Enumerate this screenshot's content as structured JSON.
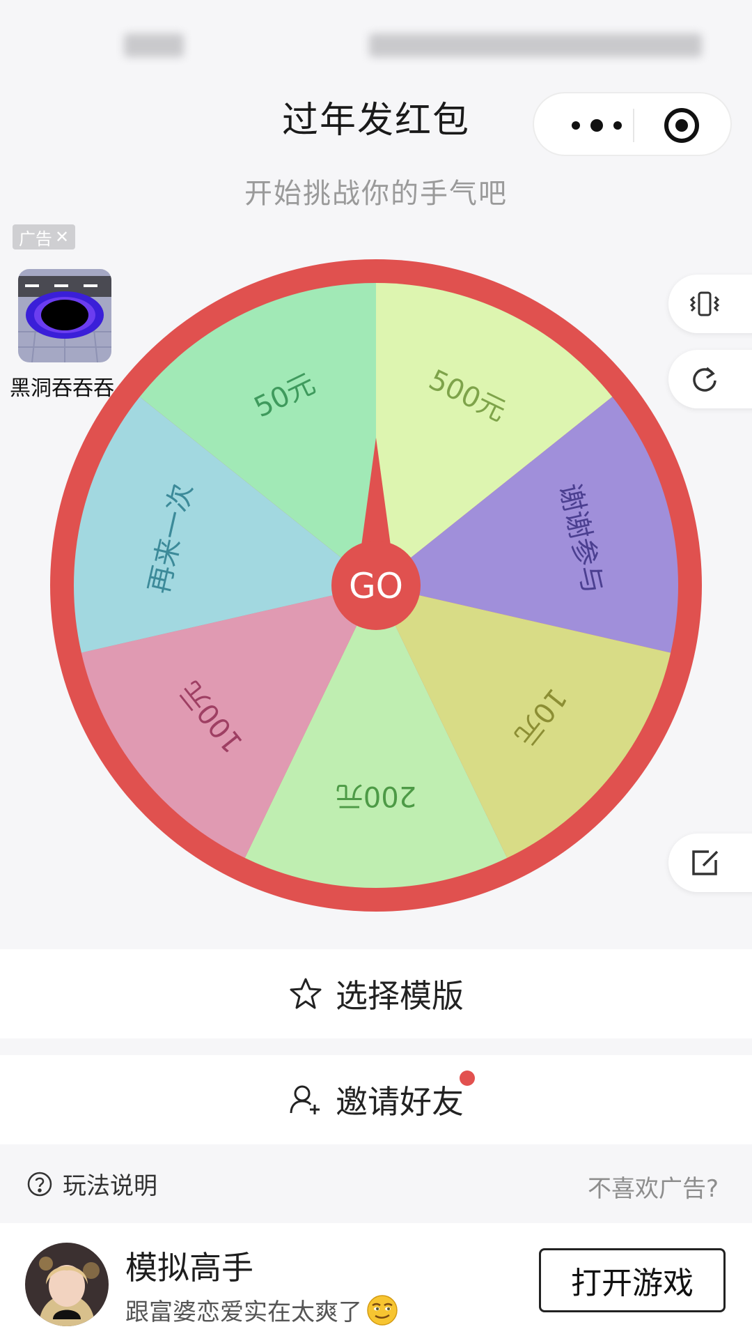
{
  "app": {
    "title": "过年发红包",
    "subtitle": "开始挑战你的手气吧"
  },
  "ad": {
    "tag": "广告",
    "app_name": "黑洞吞吞吞"
  },
  "wheel": {
    "center_label": "GO",
    "colors": {
      "rim": "#e0514f",
      "hub": "#e0514f",
      "label_default": "#6b6b6b"
    },
    "segments": [
      {
        "label": "500元",
        "color": "#ddf5b0",
        "text_color": "#7ea34a"
      },
      {
        "label": "谢谢参与",
        "color": "#a08fda",
        "text_color": "#4b3f90"
      },
      {
        "label": "10元",
        "color": "#d8dc86",
        "text_color": "#8c8e34"
      },
      {
        "label": "200元",
        "color": "#bfeeb1",
        "text_color": "#4d9a46"
      },
      {
        "label": "100元",
        "color": "#e09ab2",
        "text_color": "#9e3f63"
      },
      {
        "label": "再来一次",
        "color": "#a2d8e0",
        "text_color": "#3c8a99"
      },
      {
        "label": "50元",
        "color": "#a1e9b6",
        "text_color": "#3f9a5d"
      }
    ]
  },
  "actions": {
    "choose_template": "选择模版",
    "invite_friends": "邀请好友"
  },
  "footer": {
    "help": "玩法说明",
    "no_ads": "不喜欢广告?"
  },
  "banner": {
    "game_name": "模拟高手",
    "description": "跟富婆恋爱实在太爽了",
    "button": "打开游戏"
  }
}
